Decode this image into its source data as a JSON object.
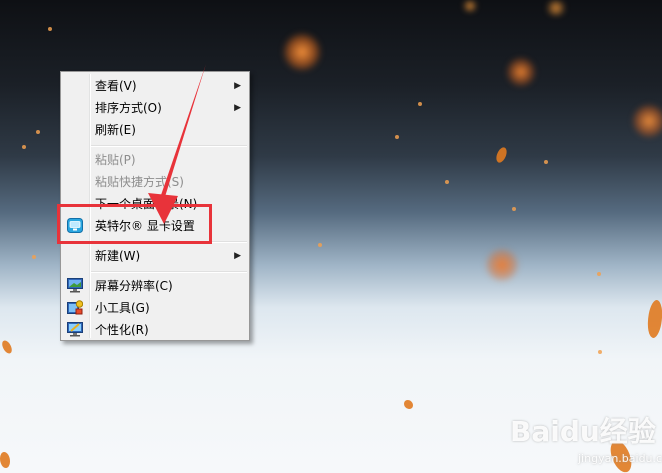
{
  "context_menu": {
    "items": [
      {
        "label": "查看(V)",
        "submenu": true,
        "enabled": true
      },
      {
        "label": "排序方式(O)",
        "submenu": true,
        "enabled": true
      },
      {
        "label": "刷新(E)",
        "submenu": false,
        "enabled": true
      },
      {
        "label": "粘贴(P)",
        "submenu": false,
        "enabled": false
      },
      {
        "label": "粘贴快捷方式(S)",
        "submenu": false,
        "enabled": false
      },
      {
        "label": "下一个桌面背景(N)",
        "submenu": false,
        "enabled": true
      },
      {
        "label": "英特尔® 显卡设置",
        "submenu": false,
        "enabled": true,
        "icon": "intel-graphics-icon"
      },
      {
        "label": "新建(W)",
        "submenu": true,
        "enabled": true
      },
      {
        "label": "屏幕分辨率(C)",
        "submenu": false,
        "enabled": true,
        "icon": "display-monitor-icon"
      },
      {
        "label": "小工具(G)",
        "submenu": false,
        "enabled": true,
        "icon": "gadgets-icon"
      },
      {
        "label": "个性化(R)",
        "submenu": false,
        "enabled": true,
        "icon": "personalize-icon"
      }
    ],
    "submenu_arrow": "▶"
  },
  "annotation": {
    "color": "#e8333a"
  },
  "watermark": {
    "text": "Baidu经验",
    "subtext": "jingyan.baidu.com"
  }
}
